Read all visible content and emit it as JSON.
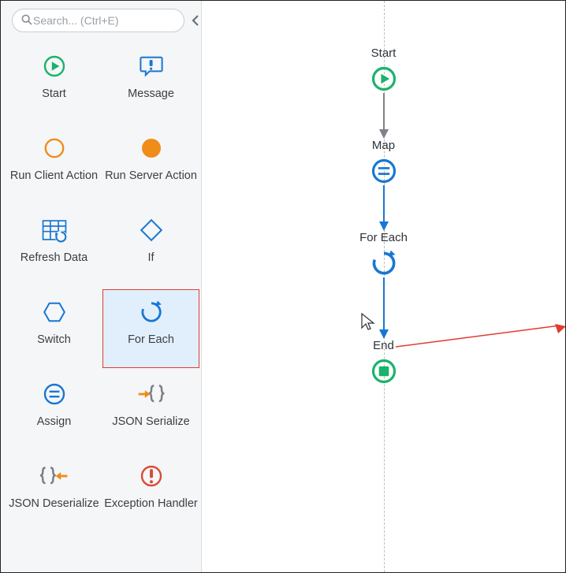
{
  "search": {
    "placeholder": "Search... (Ctrl+E)"
  },
  "tools": [
    {
      "id": "start",
      "label": "Start"
    },
    {
      "id": "message",
      "label": "Message"
    },
    {
      "id": "run-client-action",
      "label": "Run Client Action"
    },
    {
      "id": "run-server-action",
      "label": "Run Server Action"
    },
    {
      "id": "refresh-data",
      "label": "Refresh Data"
    },
    {
      "id": "if",
      "label": "If"
    },
    {
      "id": "switch",
      "label": "Switch"
    },
    {
      "id": "for-each",
      "label": "For Each",
      "selected": true
    },
    {
      "id": "assign",
      "label": "Assign"
    },
    {
      "id": "json-serialize",
      "label": "JSON Serialize"
    },
    {
      "id": "json-deserialize",
      "label": "JSON Deserialize"
    },
    {
      "id": "exception-handler",
      "label": "Exception Handler"
    }
  ],
  "flow": {
    "nodes": [
      {
        "id": "start",
        "label": "Start"
      },
      {
        "id": "map",
        "label": "Map"
      },
      {
        "id": "for-each",
        "label": "For Each"
      },
      {
        "id": "end",
        "label": "End"
      }
    ]
  }
}
